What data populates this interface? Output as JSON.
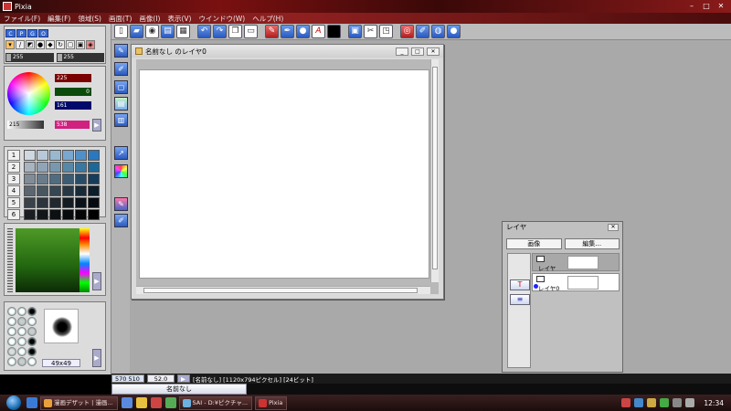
{
  "window": {
    "title": "Pixia"
  },
  "menu": [
    "ファイル(F)",
    "編集(F)",
    "領域(S)",
    "画面(T)",
    "画像(I)",
    "表示(V)",
    "ウインドウ(W)",
    "ヘルプ(H)"
  ],
  "tool_palette": {
    "tabs": [
      "C",
      "P",
      "G",
      "O"
    ],
    "left_value": "255",
    "right_value": "255"
  },
  "color": {
    "rgb_values": {
      "r": "225",
      "g": "0",
      "b": "161"
    },
    "gray_value": "215",
    "hue_value": "538",
    "colors": {
      "r_bar": "#7a0000",
      "g_bar": "#0a4a0a",
      "b_bar": "#000a6a",
      "current": "#d02080"
    }
  },
  "swatches": {
    "rows": [
      "1",
      "2",
      "3",
      "4",
      "5",
      "6"
    ]
  },
  "brush": {
    "size": "49x49"
  },
  "canvas_window": {
    "title": "名前なし のレイヤ0"
  },
  "layer_panel": {
    "title": "レイヤ",
    "buttons": [
      "画像",
      "編集..."
    ],
    "layers": [
      {
        "name": "レイヤ"
      },
      {
        "name": "レイヤ0"
      }
    ]
  },
  "status": {
    "coords": "570 510",
    "zoom": "52.0",
    "info": "[名前なし] [1120x794ピクセル] [24ビット]",
    "document_tab": "名前なし"
  },
  "taskbar": {
    "tasks": [
      "漫画デザット | 漫画...",
      "SAI - D:¥ピクチャ...",
      "Pixia"
    ],
    "time": "12:34"
  }
}
